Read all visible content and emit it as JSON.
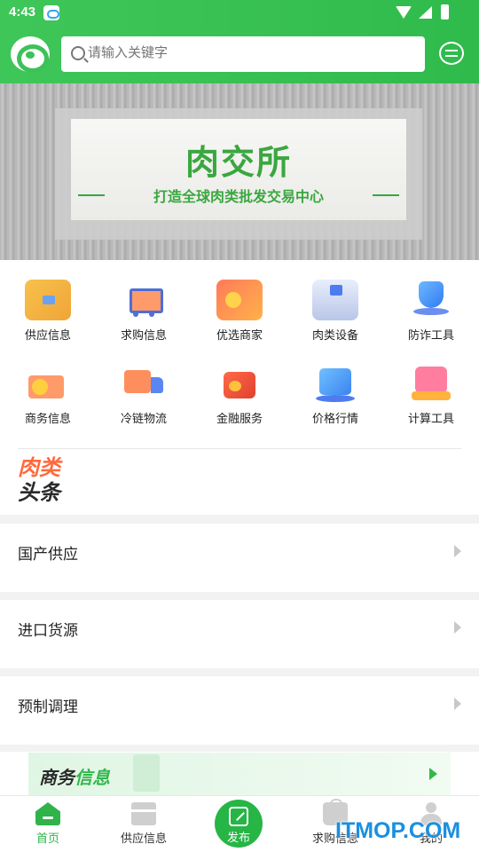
{
  "status_bar": {
    "time": "4:43"
  },
  "search": {
    "placeholder": "请输入关键字"
  },
  "banner": {
    "title": "肉交所",
    "subtitle": "打造全球肉类批发交易中心"
  },
  "categories": [
    {
      "label": "供应信息",
      "icon": "warehouse-box-icon"
    },
    {
      "label": "求购信息",
      "icon": "shopping-cart-icon"
    },
    {
      "label": "优选商家",
      "icon": "shop-badge-icon"
    },
    {
      "label": "肉类设备",
      "icon": "equipment-icon"
    },
    {
      "label": "防诈工具",
      "icon": "shield-check-icon"
    },
    {
      "label": "商务信息",
      "icon": "business-coin-icon"
    },
    {
      "label": "冷链物流",
      "icon": "cold-truck-icon"
    },
    {
      "label": "金融服务",
      "icon": "wallet-icon"
    },
    {
      "label": "价格行情",
      "icon": "price-chart-icon"
    },
    {
      "label": "计算工具",
      "icon": "calculator-icon"
    }
  ],
  "news_logo": {
    "line1": "肉类",
    "line2": "头条"
  },
  "list_rows": [
    {
      "label": "国产供应"
    },
    {
      "label": "进口货源"
    },
    {
      "label": "预制调理"
    }
  ],
  "business_banner": {
    "part1": "商务",
    "part2": "信息"
  },
  "tabbar": {
    "items": [
      {
        "label": "首页",
        "icon": "home-icon",
        "active": true
      },
      {
        "label": "供应信息",
        "icon": "store-icon",
        "active": false
      },
      {
        "label": "发布",
        "icon": "edit-icon",
        "active": false
      },
      {
        "label": "求购信息",
        "icon": "bag-icon",
        "active": false
      },
      {
        "label": "我的",
        "icon": "person-icon",
        "active": false
      }
    ]
  },
  "watermark": "ITMOP.COM",
  "colors": {
    "brand_green": "#37c052",
    "accent_orange": "#ff6a3c",
    "watermark_blue": "#1a8fe0"
  }
}
